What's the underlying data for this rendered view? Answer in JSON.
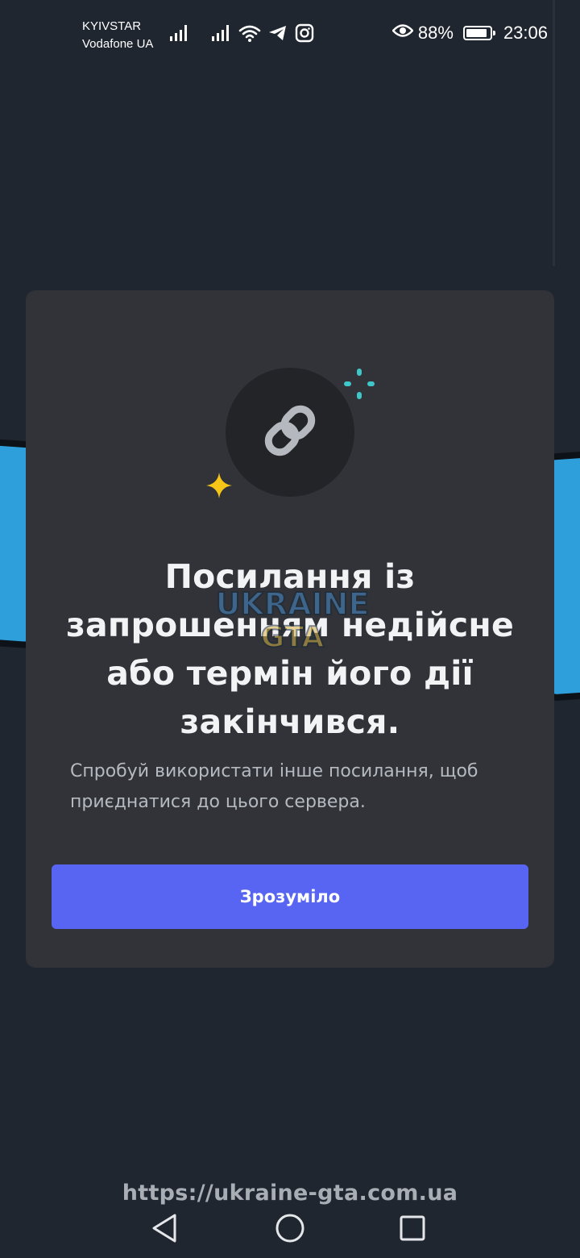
{
  "status_bar": {
    "carrier_1": "KYIVSTAR",
    "carrier_2": "Vodafone UA",
    "battery_percent": "88%",
    "battery_level": 0.88,
    "time": "23:06",
    "icons": [
      "signal-icon",
      "signal-icon",
      "wifi-icon",
      "telegram-icon",
      "instagram-icon",
      "eye-icon",
      "battery-icon"
    ]
  },
  "modal": {
    "icon": "link-icon",
    "title": "Посилання із запрошенням недійсне або термін його дії закінчився.",
    "description": "Спробуй використати інше посилання, щоб приєднатися до цього сервера.",
    "button_label": "Зрозуміло",
    "accent_color": "#5865f2",
    "sparkle_colors": [
      "#3ec6c8",
      "#f5c518"
    ]
  },
  "watermark": {
    "logo_text": "UKRAINE GTA",
    "url": "https://ukraine-gta.com.ua"
  },
  "nav_bar": {
    "buttons": [
      "back-icon",
      "home-icon",
      "recents-icon"
    ]
  }
}
